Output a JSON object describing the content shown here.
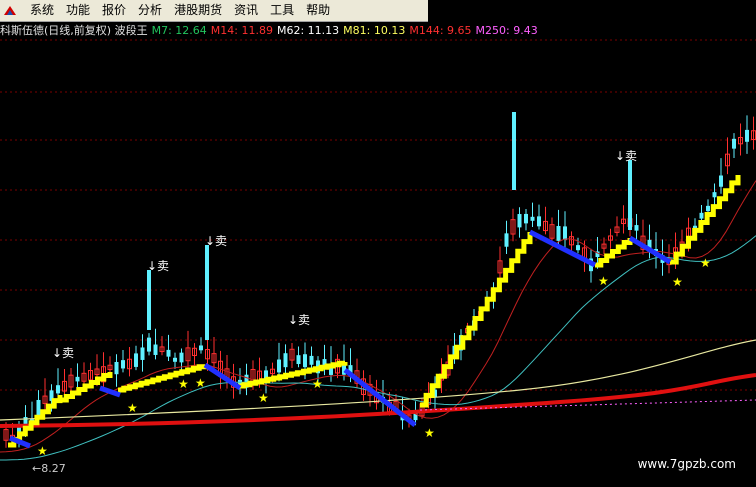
{
  "menu": [
    "系统",
    "功能",
    "报价",
    "分析",
    "港股期货",
    "资讯",
    "工具",
    "帮助"
  ],
  "indicator": {
    "title": "科斯伍德(日线,前复权) 波段王",
    "items": [
      {
        "label": "M7: 12.64",
        "color": "#22c55e"
      },
      {
        "label": "M14: 11.89",
        "color": "#ff3030"
      },
      {
        "label": "M62: 11.13",
        "color": "#ffffff"
      },
      {
        "label": "M81: 10.13",
        "color": "#ffff60"
      },
      {
        "label": "M144: 9.65",
        "color": "#ff3030"
      },
      {
        "label": "M250: 9.43",
        "color": "#ff60ff"
      }
    ]
  },
  "chart_data": {
    "type": "candlestick",
    "low_label": "8.27",
    "sell_label": "卖",
    "buy_label": "★",
    "watermark": "www.7gpzb.com"
  },
  "colors": {
    "up": "#ff3030",
    "down": "#5ff0ff",
    "signal": "#ffff00",
    "grid": "#7a0000"
  }
}
